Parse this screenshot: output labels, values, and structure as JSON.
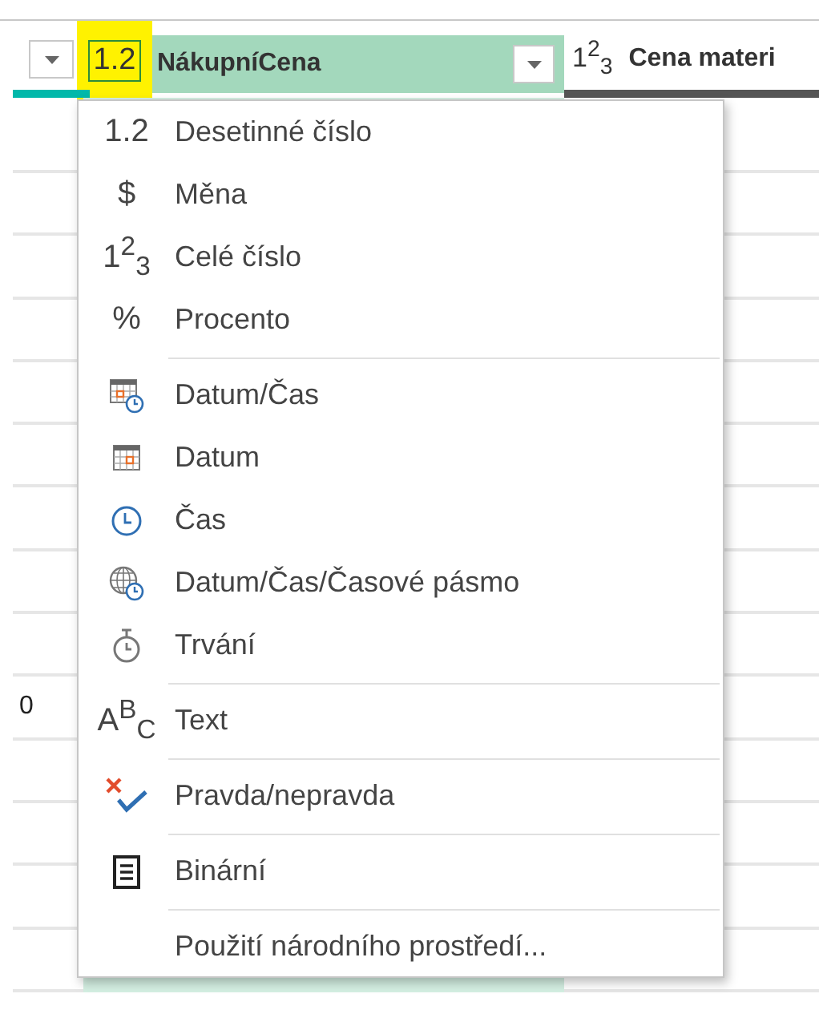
{
  "columns": [
    {
      "kind": "index"
    },
    {
      "type_icon": "1.2",
      "label": "NákupníCena",
      "selected": true
    },
    {
      "type_icon": "1$^{2}$$_{3}$",
      "label": "Cena materi",
      "selected": false
    }
  ],
  "cells": {
    "left_value": "0"
  },
  "type_menu": {
    "groups": [
      [
        {
          "kind": "glyph",
          "icon": "1.2",
          "label": "Desetinné číslo"
        },
        {
          "kind": "glyph",
          "icon": "$",
          "label": "Měna"
        },
        {
          "kind": "glyph",
          "icon": "1$^{2}$$_{3}$",
          "label": "Celé číslo"
        },
        {
          "kind": "glyph",
          "icon": "%",
          "label": "Procento"
        }
      ],
      [
        {
          "kind": "datetime",
          "label": "Datum/Čas"
        },
        {
          "kind": "date",
          "label": "Datum"
        },
        {
          "kind": "time",
          "label": "Čas"
        },
        {
          "kind": "timezone",
          "label": "Datum/Čas/Časové pásmo"
        },
        {
          "kind": "duration",
          "label": "Trvání"
        }
      ],
      [
        {
          "kind": "glyph",
          "icon": "A$^{B}$$_{C}$",
          "label": "Text"
        }
      ],
      [
        {
          "kind": "boolean",
          "label": "Pravda/nepravda"
        }
      ],
      [
        {
          "kind": "binary",
          "label": "Binární"
        }
      ],
      [
        {
          "kind": "none",
          "label": "Použití národního prostředí..."
        }
      ]
    ]
  }
}
